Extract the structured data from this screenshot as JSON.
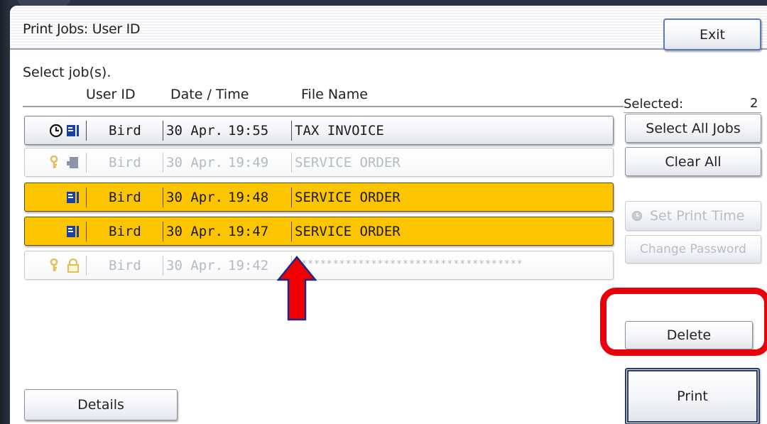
{
  "title": "Print Jobs: User ID",
  "exit_label": "Exit",
  "instruction": "Select job(s).",
  "columns": {
    "user_id": "User ID",
    "date_time": "Date / Time",
    "file_name": "File Name"
  },
  "selected": {
    "label": "Selected:",
    "count": "2"
  },
  "side_buttons": {
    "select_all": "Select All Jobs",
    "clear_all": "Clear All",
    "set_print_time": "Set Print Time",
    "change_password": "Change Password",
    "delete": "Delete",
    "print": "Print"
  },
  "details_label": "Details",
  "jobs": [
    {
      "user": "Bird",
      "date": "30 Apr.",
      "time": "19:55",
      "file": "TAX INVOICE",
      "state": "normal",
      "icons": [
        "clock-icon",
        "stored-job-icon"
      ]
    },
    {
      "user": "Bird",
      "date": "30 Apr.",
      "time": "19:49",
      "file": "SERVICE ORDER",
      "state": "disabled",
      "icons": [
        "key-icon",
        "stored-job-icon"
      ]
    },
    {
      "user": "Bird",
      "date": "30 Apr.",
      "time": "19:48",
      "file": "SERVICE ORDER",
      "state": "selected",
      "icons": [
        "stored-job-icon"
      ]
    },
    {
      "user": "Bird",
      "date": "30 Apr.",
      "time": "19:47",
      "file": "SERVICE ORDER",
      "state": "selected",
      "icons": [
        "stored-job-icon"
      ]
    },
    {
      "user": "Bird",
      "date": "30 Apr.",
      "time": "19:42",
      "file": "************************************",
      "state": "disabled",
      "icons": [
        "key-icon",
        "lock-icon"
      ]
    }
  ],
  "colors": {
    "selected_row": "#FDC500",
    "highlight_red": "#E8000B",
    "arrow_red": "#F00000",
    "arrow_outline": "#1A2A8C",
    "icon_blue": "#1A3FA8"
  }
}
